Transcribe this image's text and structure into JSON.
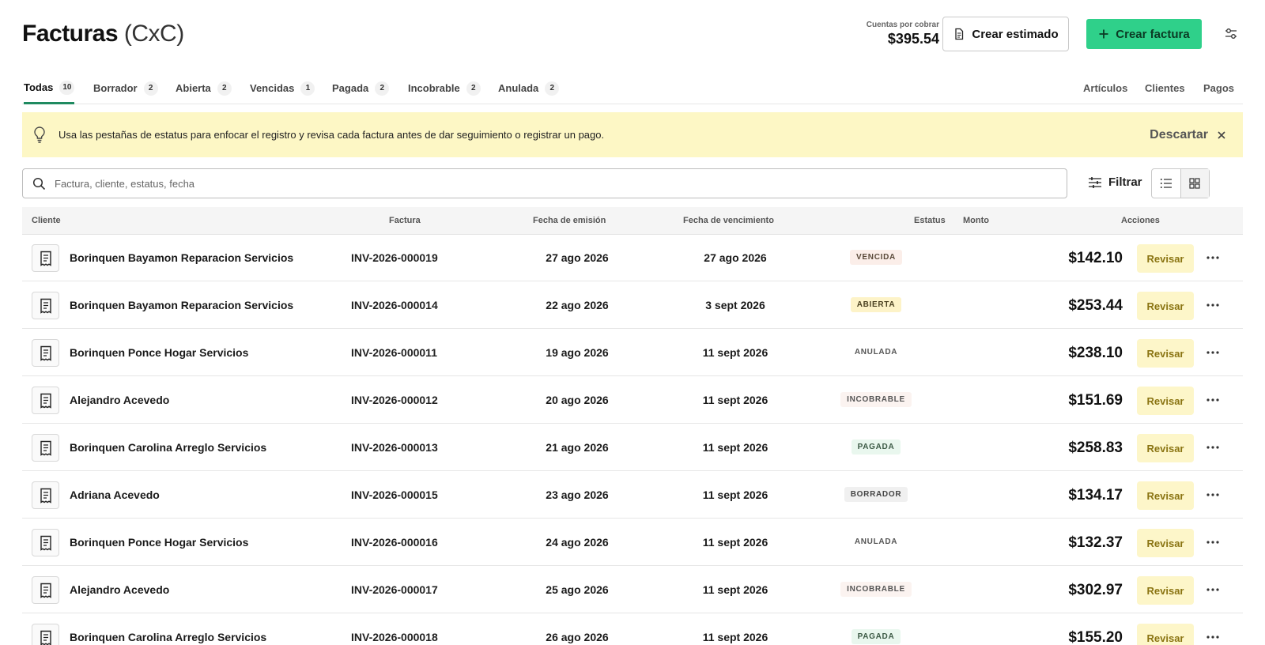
{
  "header": {
    "title_main": "Facturas",
    "title_paren": "(CxC)",
    "accounts_receivable_label": "Cuentas por cobrar",
    "accounts_receivable_value": "$395.54",
    "create_estimate_label": "Crear estimado",
    "create_invoice_label": "Crear factura",
    "icons": {
      "estimate": "document-icon",
      "create": "plus-icon",
      "settings": "sliders-icon"
    }
  },
  "tabs": [
    {
      "label": "Todas",
      "count": "10",
      "active": true
    },
    {
      "label": "Borrador",
      "count": "2"
    },
    {
      "label": "Abierta",
      "count": "2"
    },
    {
      "label": "Vencidas",
      "count": "1"
    },
    {
      "label": "Pagada",
      "count": "2"
    },
    {
      "label": "Incobrable",
      "count": "2"
    },
    {
      "label": "Anulada",
      "count": "2"
    }
  ],
  "right_links": [
    "Artículos",
    "Clientes",
    "Pagos"
  ],
  "tip": {
    "text": "Usa las pestañas de estatus para enfocar el registro y revisa cada factura antes de dar seguimiento o registrar un pago.",
    "dismiss_label": "Descartar",
    "icon": "lightbulb-icon"
  },
  "search": {
    "placeholder": "Factura, cliente, estatus, fecha",
    "value": ""
  },
  "filter_label": "Filtrar",
  "table": {
    "headers": {
      "client": "Cliente",
      "invoice": "Factura",
      "issue_date": "Fecha de emisión",
      "due_date": "Fecha de vencimiento",
      "status": "Estatus",
      "amount": "Monto",
      "actions": "Acciones"
    },
    "review_label": "Revisar",
    "rows": [
      {
        "client": "Borinquen Bayamon Reparacion Servicios",
        "invoice": "INV-2026-000019",
        "issue": "27 ago 2026",
        "due": "27 ago 2026",
        "status": "VENCIDA",
        "status_key": "vencida",
        "amount": "$142.10"
      },
      {
        "client": "Borinquen Bayamon Reparacion Servicios",
        "invoice": "INV-2026-000014",
        "issue": "22 ago 2026",
        "due": "3 sept 2026",
        "status": "ABIERTA",
        "status_key": "abierta",
        "amount": "$253.44"
      },
      {
        "client": "Borinquen Ponce Hogar Servicios",
        "invoice": "INV-2026-000011",
        "issue": "19 ago 2026",
        "due": "11 sept 2026",
        "status": "ANULADA",
        "status_key": "anulada",
        "amount": "$238.10"
      },
      {
        "client": "Alejandro Acevedo",
        "invoice": "INV-2026-000012",
        "issue": "20 ago 2026",
        "due": "11 sept 2026",
        "status": "INCOBRABLE",
        "status_key": "incobrable",
        "amount": "$151.69"
      },
      {
        "client": "Borinquen Carolina Arreglo Servicios",
        "invoice": "INV-2026-000013",
        "issue": "21 ago 2026",
        "due": "11 sept 2026",
        "status": "PAGADA",
        "status_key": "pagada",
        "amount": "$258.83"
      },
      {
        "client": "Adriana Acevedo",
        "invoice": "INV-2026-000015",
        "issue": "23 ago 2026",
        "due": "11 sept 2026",
        "status": "BORRADOR",
        "status_key": "borrador",
        "amount": "$134.17"
      },
      {
        "client": "Borinquen Ponce Hogar Servicios",
        "invoice": "INV-2026-000016",
        "issue": "24 ago 2026",
        "due": "11 sept 2026",
        "status": "ANULADA",
        "status_key": "anulada",
        "amount": "$132.37"
      },
      {
        "client": "Alejandro Acevedo",
        "invoice": "INV-2026-000017",
        "issue": "25 ago 2026",
        "due": "11 sept 2026",
        "status": "INCOBRABLE",
        "status_key": "incobrable",
        "amount": "$302.97"
      },
      {
        "client": "Borinquen Carolina Arreglo Servicios",
        "invoice": "INV-2026-000018",
        "issue": "26 ago 2026",
        "due": "11 sept 2026",
        "status": "PAGADA",
        "status_key": "pagada",
        "amount": "$155.20"
      }
    ]
  },
  "status_colors": {
    "vencida": {
      "bg": "#fbeee9",
      "fg": "#5a4a3a"
    },
    "abierta": {
      "bg": "#fdf3c8",
      "fg": "#4a4020"
    },
    "anulada": {
      "bg": "#ffffff",
      "fg": "#555555"
    },
    "incobrable": {
      "bg": "#fbf3f0",
      "fg": "#555555"
    },
    "pagada": {
      "bg": "#e9f7ee",
      "fg": "#3c5a45"
    },
    "borrador": {
      "bg": "#f0f0f0",
      "fg": "#444444"
    }
  },
  "colors": {
    "primary_green": "#2fd08a",
    "tip_background": "#fdf7c5",
    "review_background": "#fdf6c9"
  }
}
